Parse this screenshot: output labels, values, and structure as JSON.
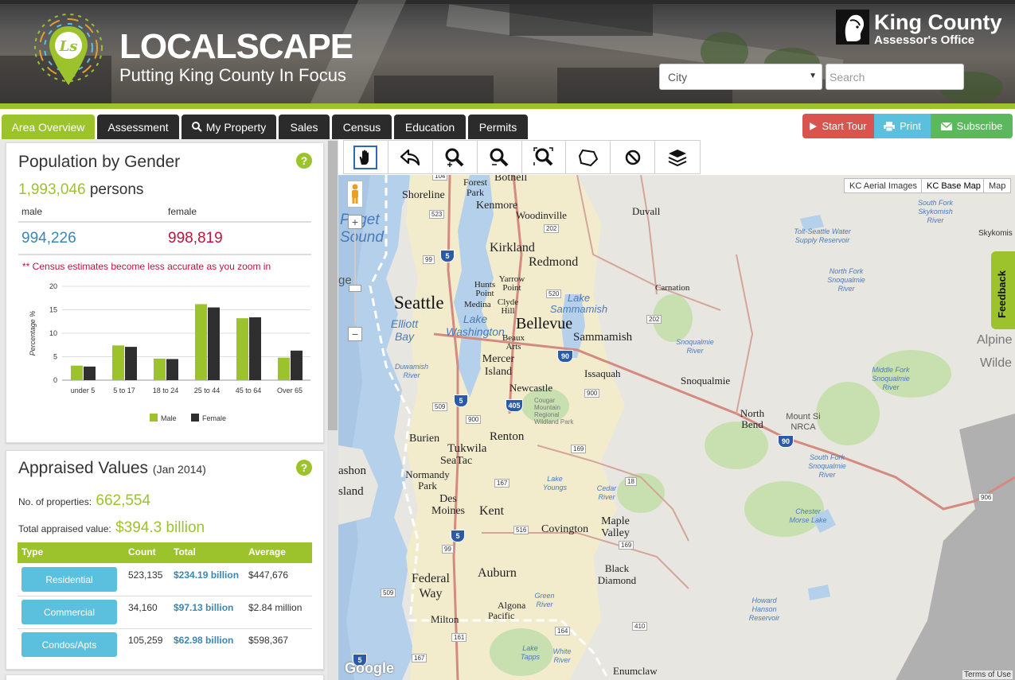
{
  "header": {
    "brand_title": "LOCALSCAPE",
    "brand_subtitle": "Putting King County In Focus",
    "logo_monogram": "Ls",
    "agency_title": "King County",
    "agency_subtitle": "Assessor's Office",
    "city_select": {
      "selected": "City"
    },
    "search": {
      "placeholder": "Search"
    }
  },
  "tabs": [
    {
      "label": "Area Overview",
      "active": true
    },
    {
      "label": "Assessment"
    },
    {
      "label": "My Property",
      "icon": "search-icon"
    },
    {
      "label": "Sales"
    },
    {
      "label": "Census"
    },
    {
      "label": "Education"
    },
    {
      "label": "Permits"
    }
  ],
  "actions": {
    "tour": {
      "label": "Start Tour",
      "icon": "play-icon",
      "color": "#d9534f"
    },
    "print": {
      "label": "Print",
      "icon": "print-icon",
      "color": "#5bc0de"
    },
    "subscribe": {
      "label": "Subscribe",
      "icon": "envelope-icon",
      "color": "#5cb85c"
    }
  },
  "population": {
    "title": "Population by Gender",
    "total": "1,993,046",
    "total_unit": "persons",
    "male_label": "male",
    "female_label": "female",
    "male_value": "994,226",
    "female_value": "998,819",
    "note": "** Census estimates become less accurate as you zoom in",
    "help": "?"
  },
  "chart_data": {
    "type": "bar",
    "categories": [
      "under 5",
      "5 to 17",
      "18 to 24",
      "25 to 44",
      "45 to 64",
      "Over 65"
    ],
    "series": [
      {
        "name": "Male",
        "values": [
          3.1,
          7.4,
          4.6,
          16.2,
          13.2,
          4.8
        ],
        "color": "#9cc32c"
      },
      {
        "name": "Female",
        "values": [
          2.9,
          7.1,
          4.5,
          15.5,
          13.4,
          6.3
        ],
        "color": "#2f2f2f"
      }
    ],
    "ylabel": "Percentage %",
    "ylim": [
      0,
      20
    ],
    "yticks": [
      0,
      5,
      10,
      15,
      20
    ],
    "grid": true,
    "legend": "bottom"
  },
  "appraised": {
    "title": "Appraised Values",
    "title_date": "(Jan 2014)",
    "help": "?",
    "properties_label": "No. of properties:",
    "properties_value": "662,554",
    "total_label": "Total appraised value:",
    "total_value": "$394.3 billion",
    "columns": [
      "Type",
      "Count",
      "Total",
      "Average"
    ],
    "rows": [
      {
        "type": "Residential",
        "count": "523,135",
        "total": "$234.19 billion",
        "average": "$447,676"
      },
      {
        "type": "Commercial",
        "count": "34,160",
        "total": "$97.13 billion",
        "average": "$2.84 million"
      },
      {
        "type": "Condos/Apts",
        "count": "105,259",
        "total": "$62.98 billion",
        "average": "$598,367"
      }
    ]
  },
  "map": {
    "map_types": [
      "KC Aerial Images",
      "KC Base Map",
      "Map"
    ],
    "selected_map_type": "KC Base Map",
    "zoom_in": "+",
    "zoom_out": "−",
    "feedback": "Feedback",
    "terms": "Terms of Use",
    "google": "Google",
    "tools": [
      "pan-hand-icon",
      "back-arrow-icon",
      "zoom-in-icon",
      "zoom-out-icon",
      "zoom-extent-icon",
      "polygon-icon",
      "clear-icon",
      "layers-icon"
    ],
    "places": {
      "bothell": "Bothell",
      "lake_forest_park": "Lake Forest Park",
      "shoreline": "Shoreline",
      "kenmore": "Kenmore",
      "woodinville": "Woodinville",
      "duvall": "Duvall",
      "south_fork_skykomish": "South Fork Skykomish River",
      "skykomish": "Skykomis",
      "puget_sound": "Puget Sound",
      "kirkland": "Kirkland",
      "redmond": "Redmond",
      "tolt_seattle": "Tolt-Seattle Water Supply Reservoir",
      "north_fork_snoqualmie": "North Fork Snoqualmie River",
      "seattle": "Seattle",
      "hunts_point": "Hunts Point",
      "yarrow_point": "Yarrow Point",
      "medina": "Medina",
      "clyde_hill": "Clyde Hill",
      "carnation": "Carnation",
      "lake_sammamish": "Lake Sammamish",
      "elliott_bay": "Elliott Bay",
      "lake_washington": "Lake Washington",
      "bellevue": "Bellevue",
      "sammamish": "Sammamish",
      "beaux_arts": "Beaux Arts",
      "snoqualmie_river": "Snoqualmie River",
      "alpine": "Alpine",
      "wilde": "Wilde",
      "mercer_island": "Mercer Island",
      "duwamish": "Duwamish River",
      "issaquah": "Issaquah",
      "middle_fork": "Middle Fork Snoqualmie River",
      "snoqualmie": "Snoqualmie",
      "newcastle": "Newcastle",
      "cougar": "Cougar Mountain Regional Wildland Park",
      "north_bend": "North Bend",
      "mount_si": "Mount Si NRCA",
      "burien": "Burien",
      "tukwila": "Tukwila",
      "renton": "Renton",
      "seatac": "SeaTac",
      "vashon": "ashon",
      "island": "sland",
      "normandy_park": "Normandy Park",
      "south_fork_snoqualmie": "South Fork Snoqualmie River",
      "lake_youngs": "Lake Youngs",
      "cedar_river": "Cedar River",
      "des_moines": "Des Moines",
      "kent": "Kent",
      "maple_valley": "Maple Valley",
      "chester_morse": "Chester Morse Lake",
      "covington": "Covington",
      "black_diamond": "Black Diamond",
      "federal_way": "Federal Way",
      "auburn": "Auburn",
      "green_river": "Green River",
      "howard_hanson": "Howard Hanson Reservoir",
      "algona": "Algona",
      "pacific": "Pacific",
      "milton": "Milton",
      "lake_tapps": "Lake Tapps",
      "white_river": "White River",
      "enumclaw": "Enumclaw",
      "ge": "ge"
    },
    "routes": {
      "i5a": "5",
      "i5b": "5",
      "i5c": "5",
      "i5d": "5",
      "i90a": "90",
      "i90b": "90",
      "i405": "405",
      "r104": "104",
      "r523": "523",
      "r99a": "99",
      "r202a": "202",
      "r520": "520",
      "r202b": "202",
      "r900a": "900",
      "r509a": "509",
      "r900b": "900",
      "r169a": "169",
      "r18": "18",
      "r167": "167",
      "r516": "516",
      "r99b": "99",
      "r169b": "169",
      "r509b": "509",
      "r161": "161",
      "r164": "164",
      "r410": "410",
      "r167b": "167",
      "r906": "906"
    }
  }
}
